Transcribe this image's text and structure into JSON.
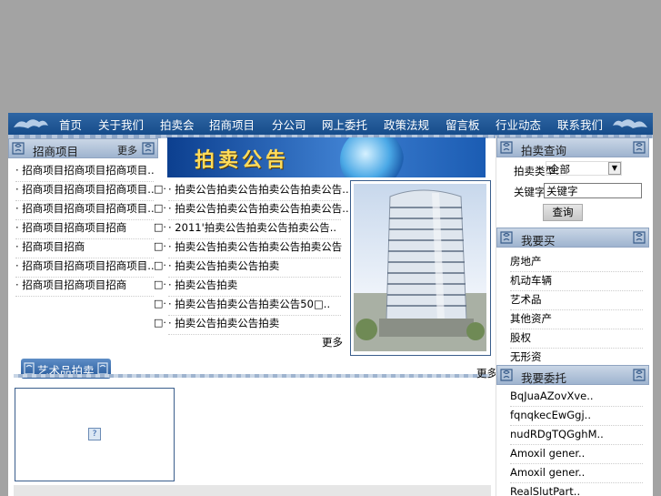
{
  "nav": {
    "items": [
      "首页",
      "关于我们",
      "拍卖会",
      "招商项目",
      "分公司",
      "网上委托",
      "政策法规",
      "留言板",
      "行业动态",
      "联系我们"
    ]
  },
  "left": {
    "header_title": "招商项目",
    "more": "更多",
    "items": [
      "· 招商项目招商项目招商项目..",
      "· 招商项目招商项目招商项目..",
      "· 招商项目招商项目招商项目..",
      "· 招商项目招商项目招商",
      "· 招商项目招商",
      "· 招商项目招商项目招商项目..",
      "· 招商项目招商项目招商"
    ]
  },
  "middle": {
    "banner_title": "拍卖公告",
    "list_markers": [
      "□·",
      "□·",
      "□·",
      "□·",
      "□·",
      "□·",
      "□·",
      "□·"
    ],
    "items": [
      "· 拍卖公告拍卖公告拍卖公告拍卖公告..",
      "· 拍卖公告拍卖公告拍卖公告拍卖公告..",
      "· 2011'拍卖公告拍卖公告拍卖公告..",
      "· 拍卖公告拍卖公告拍卖公告拍卖公告",
      "· 拍卖公告拍卖公告拍卖",
      "· 拍卖公告拍卖",
      "· 拍卖公告拍卖公告拍卖公告50□..",
      "· 拍卖公告拍卖公告拍卖"
    ],
    "more": "更多"
  },
  "art": {
    "header_title": "艺术品拍卖",
    "more": "更多",
    "broken_image_glyph": "?"
  },
  "right": {
    "search": {
      "header_title": "拍卖查询",
      "type_label": "拍卖类型:",
      "type_value": "全部",
      "keyword_label": "关键字:",
      "keyword_value": "关键字",
      "submit_label": "查询"
    },
    "buy": {
      "header_title": "我要买",
      "items": [
        "房地产",
        "机动车辆",
        "艺术品",
        "其他资产",
        "股权",
        "无形资"
      ]
    },
    "consign": {
      "header_title": "我要委托",
      "items": [
        "BqJuaAZovXve..",
        "fqnqkecEwGgj..",
        "nudRDgTQGghM..",
        "Amoxil gener..",
        "Amoxil gener..",
        "RealSlutPart.."
      ]
    }
  },
  "colors": {
    "nav_bg": "#1f5796",
    "page_bg": "#a3a3a3",
    "banner_title": "#ffdc5b"
  }
}
